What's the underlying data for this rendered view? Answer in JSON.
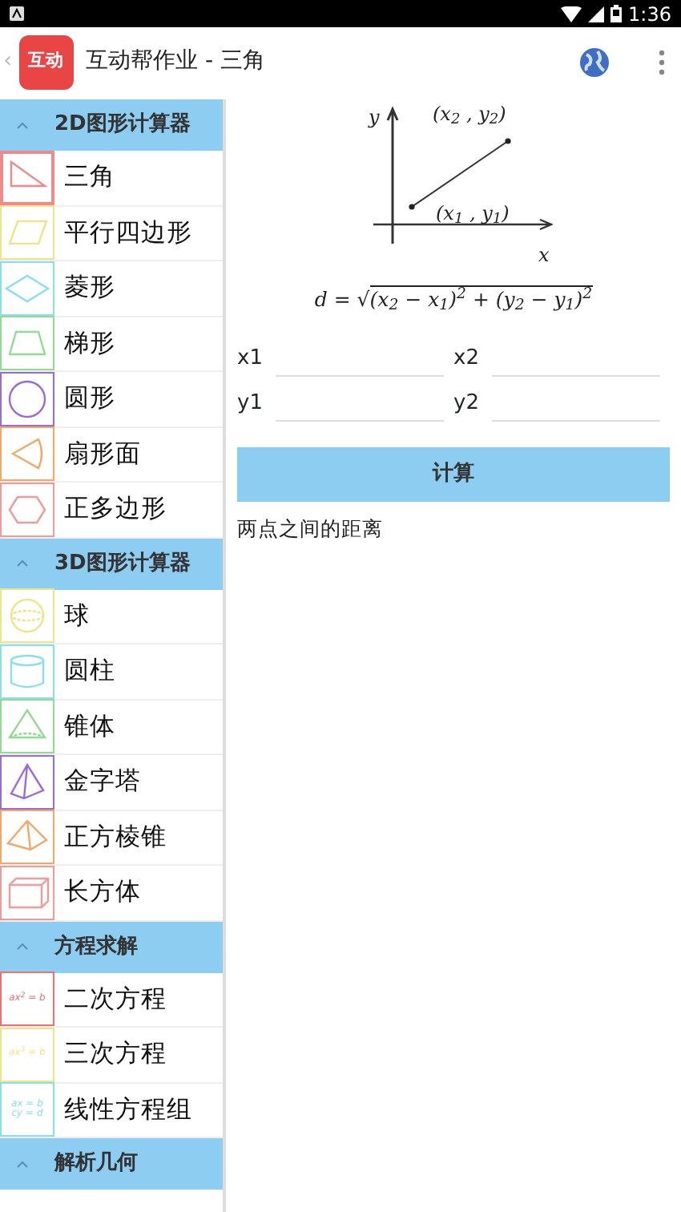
{
  "status_bar": {
    "time": "1:36"
  },
  "app_bar": {
    "back": "‹",
    "logo_text": "互动",
    "title": "互动帮作业 - 三角"
  },
  "sidebar": {
    "sections": [
      {
        "title": "2D图形计算器",
        "expanded": true,
        "items": [
          {
            "label": "三角",
            "kind": "triangle",
            "color": "#f08a8a",
            "selected": true
          },
          {
            "label": "平行四边形",
            "kind": "parallelogram",
            "color": "#eee58a",
            "selected": false
          },
          {
            "label": "菱形",
            "kind": "rhombus",
            "color": "#88e0ee",
            "selected": false
          },
          {
            "label": "梯形",
            "kind": "trapezoid",
            "color": "#92dc92",
            "selected": false
          },
          {
            "label": "圆形",
            "kind": "circle",
            "color": "#9a6ad8",
            "selected": false
          },
          {
            "label": "扇形面",
            "kind": "sector",
            "color": "#f4a866",
            "selected": false
          },
          {
            "label": "正多边形",
            "kind": "polygon",
            "color": "#f09a9a",
            "selected": false
          }
        ]
      },
      {
        "title": "3D图形计算器",
        "expanded": true,
        "items": [
          {
            "label": "球",
            "kind": "sphere",
            "color": "#eee58a",
            "selected": false
          },
          {
            "label": "圆柱",
            "kind": "cylinder",
            "color": "#88e0ee",
            "selected": false
          },
          {
            "label": "锥体",
            "kind": "cone",
            "color": "#92dc92",
            "selected": false
          },
          {
            "label": "金字塔",
            "kind": "pyramid",
            "color": "#9a6ad8",
            "selected": false
          },
          {
            "label": "正方棱锥",
            "kind": "square-pyramid",
            "color": "#f4a866",
            "selected": false
          },
          {
            "label": "长方体",
            "kind": "cuboid",
            "color": "#f09a9a",
            "selected": false
          }
        ]
      },
      {
        "title": "方程求解",
        "expanded": true,
        "items": [
          {
            "label": "二次方程",
            "kind": "equation",
            "color": "#f07070",
            "icon_text": [
              "ax$^{2}$ = b"
            ],
            "selected": false
          },
          {
            "label": "三次方程",
            "kind": "equation",
            "color": "#eee58a",
            "icon_text": [
              "ax$^{3}$ = b"
            ],
            "selected": false
          },
          {
            "label": "线性方程组",
            "kind": "equation",
            "color": "#88e0ee",
            "icon_text": [
              "ax = b",
              "cy = d"
            ],
            "selected": false
          }
        ]
      },
      {
        "title": "解析几何",
        "expanded": true
      }
    ]
  },
  "diagram": {
    "y_axis": "y",
    "x_axis": "x",
    "point_2": "(x$_{2}$ , y$_{2}$)",
    "point_1": "(x$_{1}$ , y$_{1}$)"
  },
  "formula": {
    "prefix": "d = √",
    "radicand": "(x$_{2}$ − x$_{1}$)$^{2}$ + (y$_{2}$ − y$_{1}$)$^{2}$"
  },
  "fields": [
    {
      "label": "x1"
    },
    {
      "label": "x2"
    },
    {
      "label": "y1"
    },
    {
      "label": "y2"
    }
  ],
  "button": "计算",
  "result": "两点之间的距离"
}
